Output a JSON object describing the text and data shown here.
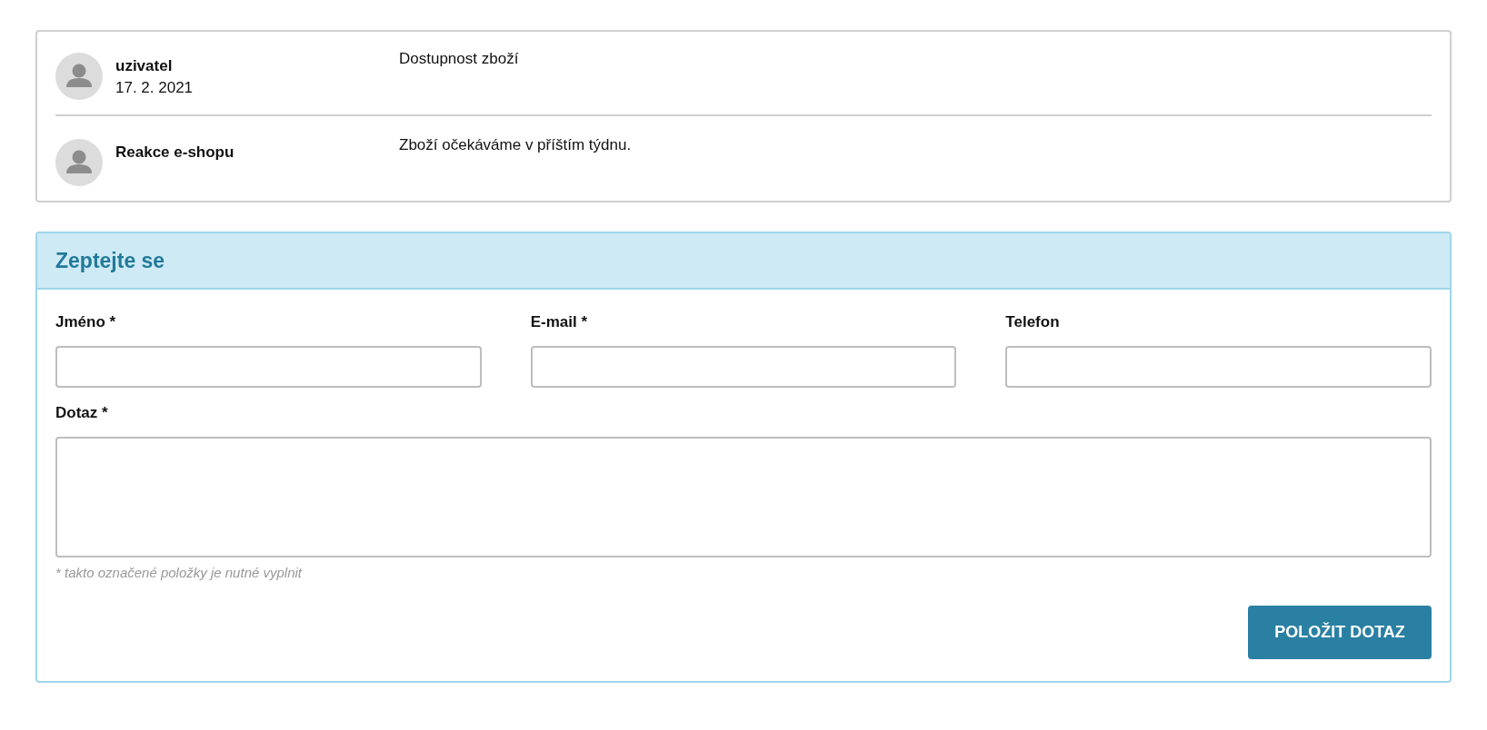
{
  "thread": [
    {
      "author": "uzivatel",
      "date": "17. 2. 2021",
      "message": "Dostupnost zboží"
    },
    {
      "author": "Reakce e-shopu",
      "message": "Zboží očekáváme v příštím týdnu."
    }
  ],
  "form": {
    "title": "Zeptejte se",
    "fields": [
      {
        "label": "Jméno *",
        "kind": "input"
      },
      {
        "label": "E-mail *",
        "kind": "input"
      },
      {
        "label": "Telefon",
        "kind": "input"
      },
      {
        "label": "Dotaz *",
        "kind": "textarea"
      }
    ],
    "note": "* takto označené položky je nutné vyplnit",
    "button": "POLOŽIT DOTAZ"
  }
}
